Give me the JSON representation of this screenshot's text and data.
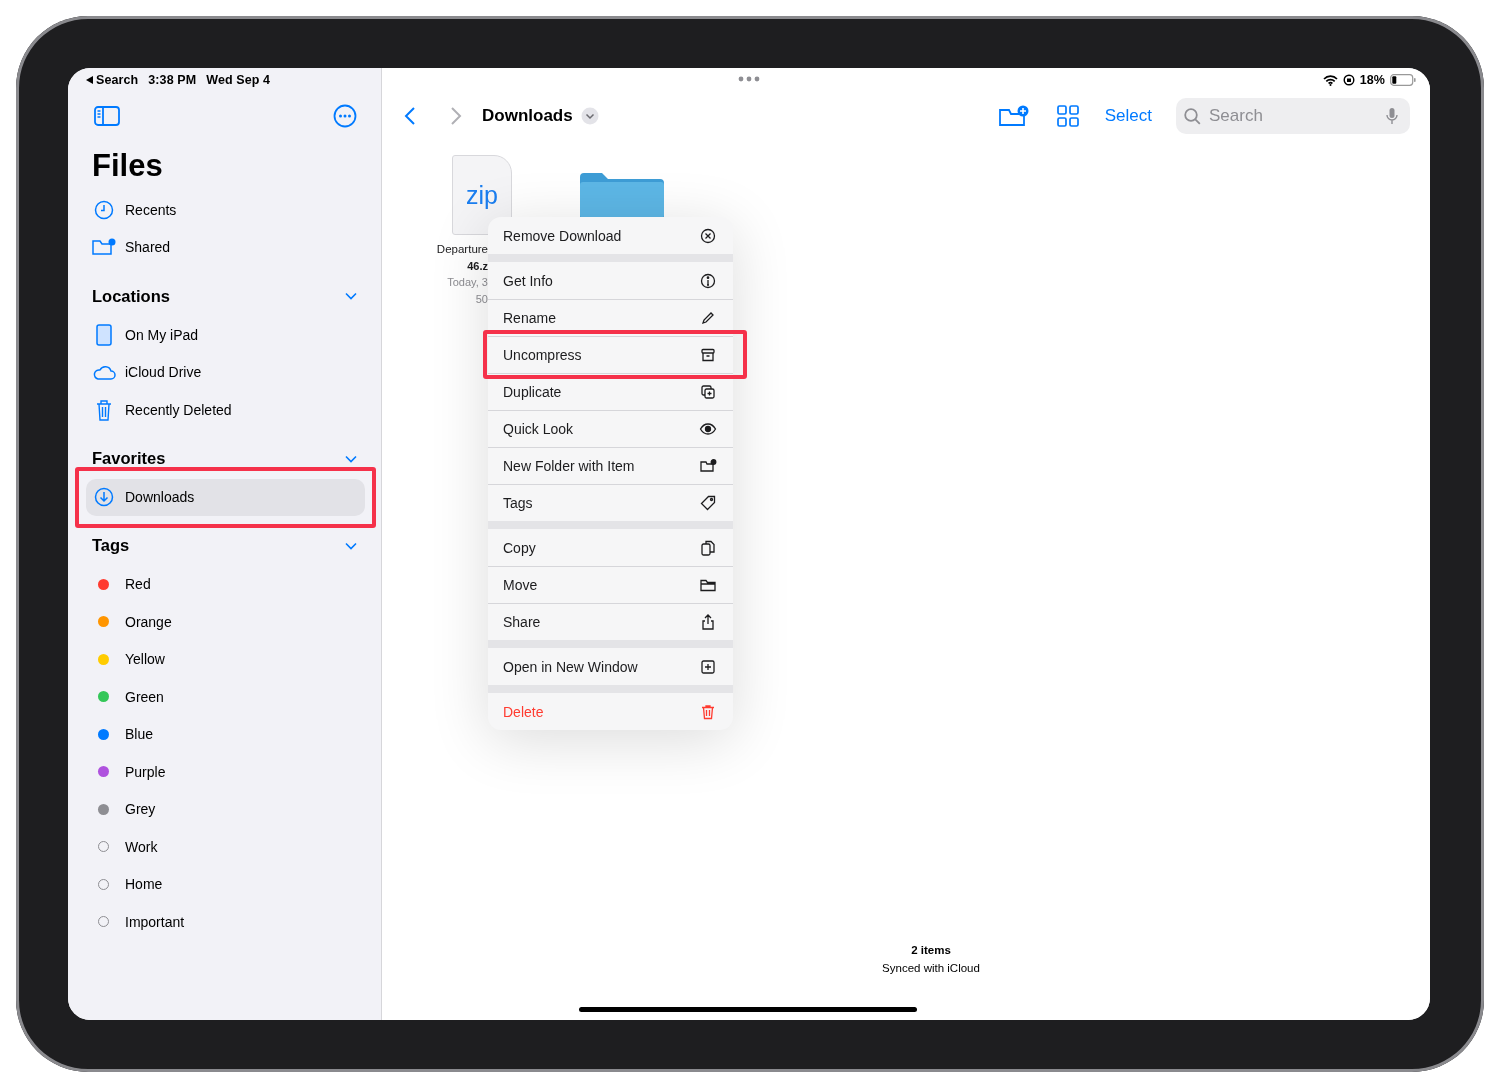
{
  "status_bar": {
    "back_label": "Search",
    "time": "3:38 PM",
    "date": "Wed Sep 4",
    "battery": "18%"
  },
  "sidebar": {
    "title": "Files",
    "top_items": [
      {
        "label": "Recents",
        "selected": false
      },
      {
        "label": "Shared",
        "selected": false
      }
    ],
    "sections": [
      {
        "title": "Locations",
        "expanded": true,
        "items": [
          {
            "label": "On My iPad",
            "selected": false
          },
          {
            "label": "iCloud Drive",
            "selected": false
          },
          {
            "label": "Recently Deleted",
            "selected": false
          }
        ]
      },
      {
        "title": "Favorites",
        "expanded": true,
        "items": [
          {
            "label": "Downloads",
            "selected": true,
            "annotated": true
          }
        ]
      },
      {
        "title": "Tags",
        "expanded": true,
        "items": [
          {
            "label": "Red",
            "kind": "color",
            "color": "#ff3b30"
          },
          {
            "label": "Orange",
            "kind": "color",
            "color": "#ff9500"
          },
          {
            "label": "Yellow",
            "kind": "color",
            "color": "#ffcc00"
          },
          {
            "label": "Green",
            "kind": "color",
            "color": "#34c759"
          },
          {
            "label": "Blue",
            "kind": "color",
            "color": "#007aff"
          },
          {
            "label": "Purple",
            "kind": "color",
            "color": "#af52de"
          },
          {
            "label": "Grey",
            "kind": "color",
            "color": "#8e8e93"
          },
          {
            "label": "Work",
            "kind": "plain"
          },
          {
            "label": "Home",
            "kind": "plain"
          },
          {
            "label": "Important",
            "kind": "plain"
          }
        ]
      }
    ]
  },
  "toolbar": {
    "title": "Downloads",
    "select": "Select",
    "search": {
      "placeholder": "Search"
    }
  },
  "files": [
    {
      "kind": "zip",
      "badge": "zip",
      "lines": [
        "Departure",
        "46.z",
        "Today, 3",
        "50"
      ]
    },
    {
      "kind": "folder"
    }
  ],
  "context_menu": {
    "groups": [
      [
        {
          "label": "Remove Download",
          "destructive": false,
          "annotated": false
        }
      ],
      [
        {
          "label": "Get Info",
          "destructive": false,
          "annotated": false
        },
        {
          "label": "Rename",
          "destructive": false,
          "annotated": false
        },
        {
          "label": "Uncompress",
          "destructive": false,
          "annotated": true
        },
        {
          "label": "Duplicate",
          "destructive": false,
          "annotated": false
        },
        {
          "label": "Quick Look",
          "destructive": false,
          "annotated": false
        },
        {
          "label": "New Folder with Item",
          "destructive": false,
          "annotated": false
        },
        {
          "label": "Tags",
          "destructive": false,
          "annotated": false
        }
      ],
      [
        {
          "label": "Copy",
          "destructive": false,
          "annotated": false
        },
        {
          "label": "Move",
          "destructive": false,
          "annotated": false
        },
        {
          "label": "Share",
          "destructive": false,
          "annotated": false
        }
      ],
      [
        {
          "label": "Open in New Window",
          "destructive": false,
          "annotated": false
        }
      ],
      [
        {
          "label": "Delete",
          "destructive": true,
          "annotated": false
        }
      ]
    ]
  },
  "footer": {
    "count": "2 items",
    "sync": "Synced with iCloud"
  }
}
